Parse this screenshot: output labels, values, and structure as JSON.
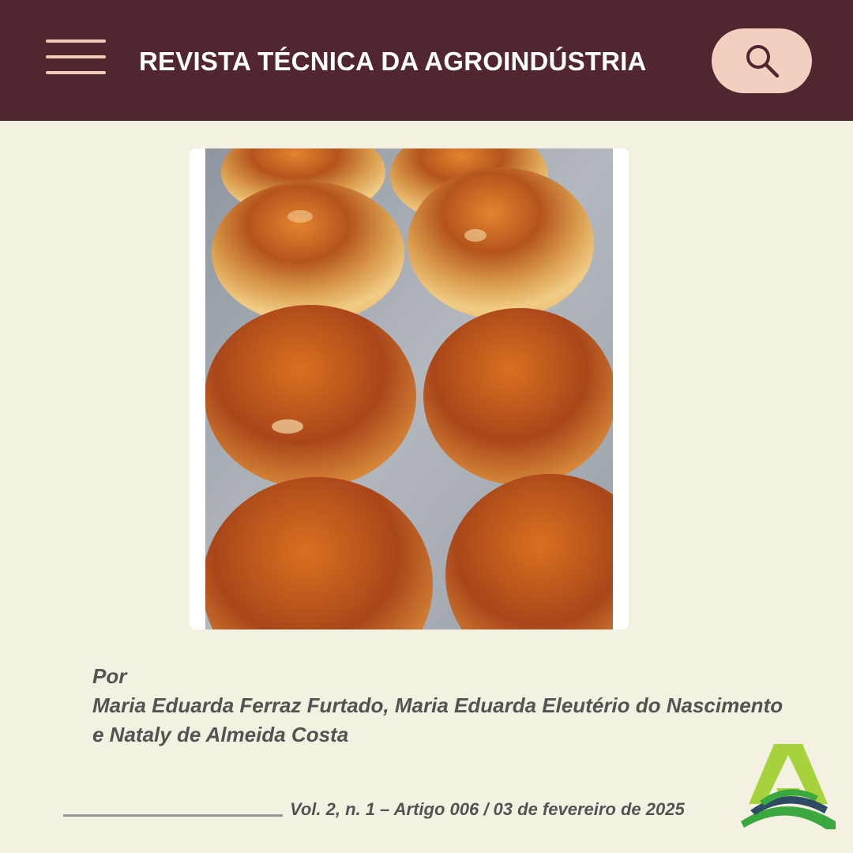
{
  "header": {
    "title": "REVISTA TÉCNICA DA AGROINDÚSTRIA",
    "menu_icon": "hamburger-menu-icon",
    "search_icon": "search-icon",
    "background_color": "#51262e",
    "accent_color": "#f3cfc2"
  },
  "article": {
    "image_subject": "bread-rolls-photo",
    "by_label": "Por",
    "authors": "Maria Eduarda Ferraz Furtado, Maria Eduarda Eleutério do Nascimento e Nataly de Almeida Costa"
  },
  "footer": {
    "issue": "Vol. 2, n. 1 – Artigo 006 / 03 de fevereiro de 2025",
    "logo": "agroindustria-logo"
  }
}
